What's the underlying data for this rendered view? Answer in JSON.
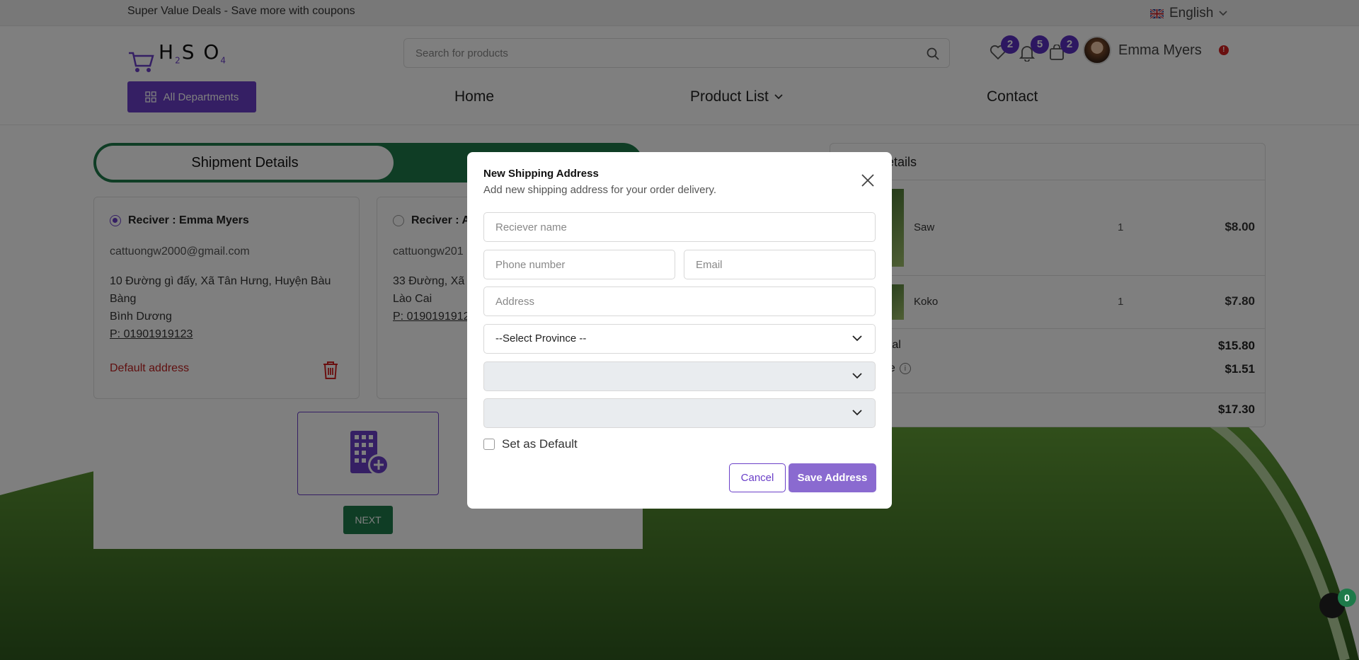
{
  "topbar": {
    "promo": "Super Value Deals - Save more with coupons",
    "language": "English"
  },
  "header": {
    "logo_text": "HSO",
    "logo_sub_2": "2",
    "logo_sub_4": "4",
    "search_placeholder": "Search for products",
    "wishlist_count": "2",
    "notification_count": "5",
    "cart_count": "2",
    "user_name": "Emma Myers",
    "alert": "!",
    "all_departments": "All Departments",
    "nav": {
      "home": "Home",
      "product_list": "Product List",
      "contact": "Contact"
    }
  },
  "checkout": {
    "active_step": "Shipment Details",
    "addresses": [
      {
        "receiver": "Reciver : Emma Myers",
        "email": "cattuongw2000@gmail.com",
        "address_line1": "10 Đường gì đấy, Xã Tân Hưng, Huyện Bàu Bàng",
        "address_line2": "Bình Dương",
        "phone": "P: 01901919123",
        "default_label": "Default address"
      },
      {
        "receiver": "Reciver : A",
        "email": "cattuongw201",
        "address_line1": "33 Đường, Xã",
        "address_line2": "Lào Cai",
        "phone": "P: 0190191912"
      }
    ],
    "next_label": "NEXT"
  },
  "order": {
    "title": "etails",
    "items": [
      {
        "name": "Saw",
        "qty": "1",
        "price": "$8.00"
      },
      {
        "name": "Koko",
        "qty": "1",
        "price": "$7.80"
      }
    ],
    "subtotal_label": "otal",
    "subtotal": "$15.80",
    "fee_label": "ee",
    "fee": "$1.51",
    "total": "$17.30"
  },
  "modal": {
    "title": "New Shipping Address",
    "subtitle": "Add new shipping address for your order delivery.",
    "receiver_placeholder": "Reciever name",
    "phone_placeholder": "Phone number",
    "email_placeholder": "Email",
    "address_placeholder": "Address",
    "province_select": "--Select Province --",
    "district_select": "",
    "ward_select": "",
    "set_default": "Set as Default",
    "cancel": "Cancel",
    "save": "Save Address"
  },
  "chat": {
    "count": "0"
  },
  "colors": {
    "primary": "#6a3fc8",
    "green": "#1e7a4a",
    "danger": "#c02020"
  }
}
